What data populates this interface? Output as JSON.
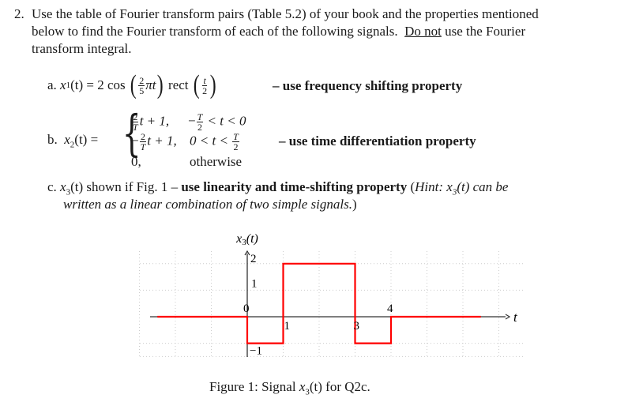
{
  "question": {
    "number": "2.",
    "intro_lines": [
      "Use the table of Fourier transform pairs (Table 5.2) of your book and the properties mentioned",
      "below to find the Fourier transform of each of the following signals.",
      "transform integral."
    ],
    "emphasis": "Do not",
    "intro_tail": " use the Fourier"
  },
  "parts": {
    "a": {
      "label": "a.",
      "lhs": "x",
      "lhs_sub": "1",
      "lhs_arg": "(t) = 2 cos",
      "cos_frac_num": "2",
      "cos_frac_den": "5",
      "cos_tail": "πt",
      "rect": "rect",
      "rect_frac_num": "t",
      "rect_frac_den": "2",
      "hint": "– use frequency shifting property"
    },
    "b": {
      "label": "b.",
      "lhs": "x",
      "lhs_sub": "2",
      "lhs_arg": "(t) =",
      "cases": [
        {
          "expr_pre": "",
          "frac_num": "2",
          "frac_den": "T",
          "expr_post": "t + 1,",
          "cond_pre": "−",
          "cond_num": "T",
          "cond_den": "2",
          "cond_post": " < t < 0"
        },
        {
          "expr_pre": "−",
          "frac_num": "2",
          "frac_den": "T",
          "expr_post": "t + 1,",
          "cond_pre": "0 < t < ",
          "cond_num": "T",
          "cond_den": "2",
          "cond_post": ""
        },
        {
          "expr": "0,",
          "cond": "otherwise"
        }
      ],
      "hint": "– use time differentiation property"
    },
    "c": {
      "label": "c.",
      "lhs": "x",
      "lhs_sub": "3",
      "line1_a": "(t) shown if Fig. 1 – ",
      "line1_bold": "use linearity and time-shifting property",
      "line1_hint_open": " (",
      "line1_hint": "Hint: x",
      "line1_hint_sub": "3",
      "line1_hint_tail": "(t) can be",
      "line2": "written as a linear combination of two simple signals.",
      "line2_close": ")"
    }
  },
  "figure": {
    "caption_prefix": "Figure 1: Signal ",
    "caption_var": "x",
    "caption_sub": "3",
    "caption_suffix": "(t) for Q2c.",
    "signal_color": "#ff0000",
    "axis_color": "#333333",
    "grid_color": "#cccccc"
  },
  "chart_data": {
    "type": "line",
    "title": "Figure 1: Signal x3(t) for Q2c.",
    "xlabel": "t",
    "ylabel": "x3(t)",
    "xlim": [
      -3,
      7.5
    ],
    "ylim": [
      -1.5,
      2.5
    ],
    "grid": true,
    "x_tick_labels": [
      "0",
      "1",
      "3",
      "4"
    ],
    "y_tick_labels": [
      "2",
      "1",
      "−1"
    ],
    "series": [
      {
        "name": "x3(t)",
        "points": [
          [
            -2.5,
            0
          ],
          [
            0,
            0
          ],
          [
            0,
            -1
          ],
          [
            1,
            -1
          ],
          [
            1,
            2
          ],
          [
            3,
            2
          ],
          [
            3,
            -1
          ],
          [
            4,
            -1
          ],
          [
            4,
            0
          ],
          [
            6.5,
            0
          ]
        ]
      }
    ]
  }
}
